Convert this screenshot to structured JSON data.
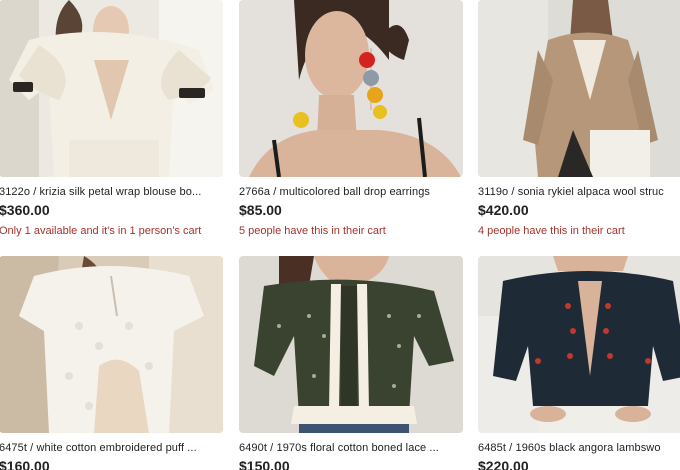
{
  "listings": [
    {
      "title": "3122o / krizia silk petal wrap blouse bo...",
      "price": "$360.00",
      "note": "Only 1 available and it's in 1 person's cart",
      "image": "cream-ruffle-blouse-photo"
    },
    {
      "title": "2766a / multicolored ball drop earrings",
      "price": "$85.00",
      "note": "5 people have this in their cart",
      "image": "model-ball-drop-earrings-photo"
    },
    {
      "title": "3119o / sonia rykiel alpaca wool struc",
      "price": "$420.00",
      "note": "4 people have this in their cart",
      "image": "camel-wool-blazer-photo"
    },
    {
      "title": "6475t / white cotton embroidered puff ...",
      "price": "$160.00",
      "note": "",
      "image": "white-embroidered-blouse-photo"
    },
    {
      "title": "6490t / 1970s floral cotton boned lace ...",
      "price": "$150.00",
      "note": "",
      "image": "green-floral-corset-top-photo"
    },
    {
      "title": "6485t / 1960s black angora lambswo",
      "price": "$220.00",
      "note": "",
      "image": "black-embroidered-cardigan-photo"
    }
  ],
  "colors": {
    "text": "#222222",
    "note_text": "#a3332e",
    "background": "#ffffff"
  }
}
